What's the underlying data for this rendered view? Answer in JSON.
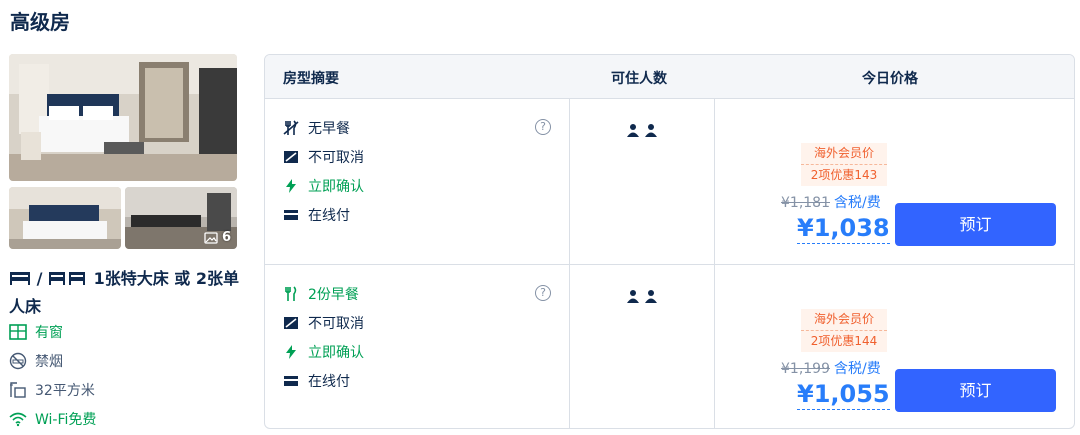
{
  "room": {
    "title": "高级房",
    "photo_count": "6",
    "bed_desc": "1张特大床 或 2张单人床",
    "bed_slash": "/",
    "features": [
      {
        "label": "有窗",
        "icon": "window-icon"
      },
      {
        "label": "禁烟",
        "icon": "no-smoking-icon"
      },
      {
        "label": "32平方米",
        "icon": "area-icon"
      },
      {
        "label": "Wi-Fi免费",
        "icon": "wifi-icon"
      }
    ]
  },
  "table": {
    "headers": [
      "房型摘要",
      "可住人数",
      "今日价格"
    ],
    "rows": [
      {
        "meal": "无早餐",
        "cancel": "不可取消",
        "confirm": "立即确认",
        "payment": "在线付",
        "help": "?",
        "badge_line1": "海外会员价",
        "badge_line2": "2项优惠143",
        "original_price": "¥1,181",
        "tax_label": "含税/费",
        "price": "¥1,038",
        "book_label": "预订"
      },
      {
        "meal": "2份早餐",
        "cancel": "不可取消",
        "confirm": "立即确认",
        "payment": "在线付",
        "help": "?",
        "badge_line1": "海外会员价",
        "badge_line2": "2项优惠144",
        "original_price": "¥1,199",
        "tax_label": "含税/费",
        "price": "¥1,055",
        "book_label": "预订"
      }
    ]
  },
  "colors": {
    "brand_blue": "#287dfa",
    "button_blue": "#3264ff",
    "green": "#00a055",
    "promo_orange": "#f0602e"
  }
}
